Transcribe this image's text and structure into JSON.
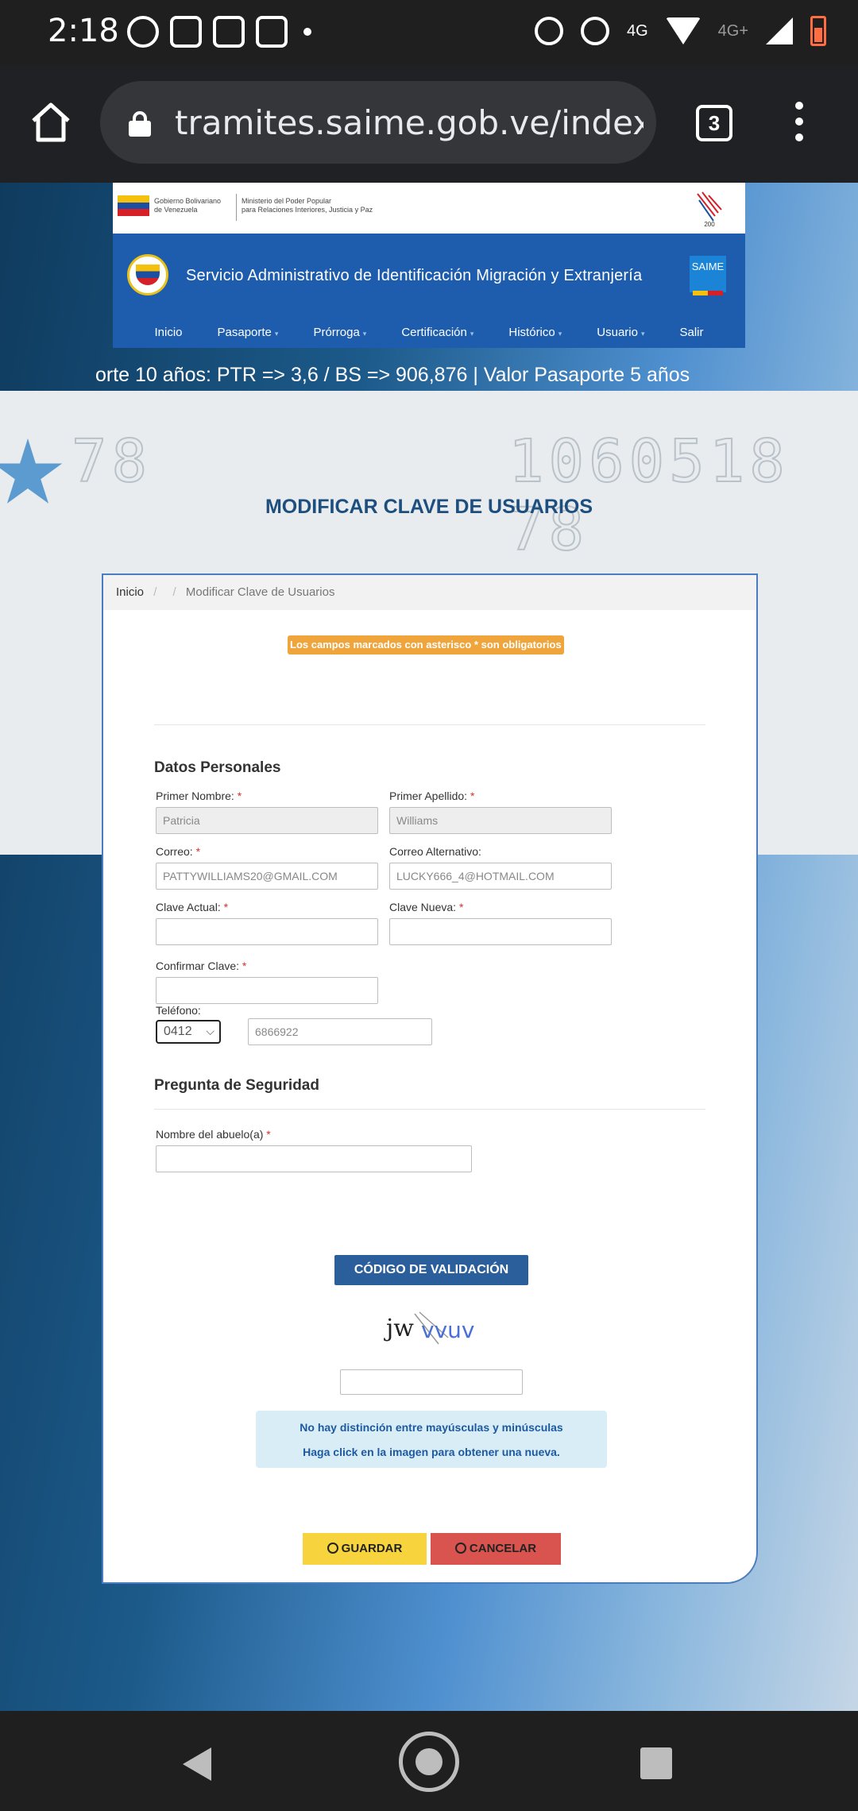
{
  "status_bar": {
    "time": "2:18",
    "app_icons": [
      "whatsapp-icon",
      "discord-icon",
      "teams-icon",
      "teams-icon"
    ],
    "network_label": "4G",
    "network_secondary": "4G+"
  },
  "browser": {
    "url": "tramites.saime.gob.ve/index.ph",
    "tab_count": "3"
  },
  "header": {
    "gov_text_line1": "Gobierno Bolivariano",
    "gov_text_line2": "de Venezuela",
    "ministry_line1": "Ministerio del Poder Popular",
    "ministry_line2": "para Relaciones Interiores, Justicia y Paz",
    "site_title": "Servicio Administrativo de Identificación Migración y Extranjería",
    "logo_text": "SAIME",
    "nav": [
      "Inicio",
      "Pasaporte",
      "Prórroga",
      "Certificación",
      "Histórico",
      "Usuario",
      "Salir"
    ]
  },
  "ticker": "orte 10 años: PTR => 3,6 / BS => 906,876 | Valor Pasaporte 5 años",
  "page_title": "MODIFICAR CLAVE DE USUARIOS",
  "breadcrumb": {
    "home": "Inicio",
    "separator": "/",
    "current": "Modificar Clave de Usuarios"
  },
  "required_notice": "Los campos marcados con asterisco * son obligatorios",
  "personal": {
    "title": "Datos Personales",
    "first_name_label": "Primer Nombre:",
    "first_name_value": "Patricia",
    "last_name_label": "Primer Apellido:",
    "last_name_value": "Williams",
    "email_label": "Correo:",
    "email_value": "PATTYWILLIAMS20@GMAIL.COM",
    "alt_email_label": "Correo Alternativo:",
    "alt_email_value": "LUCKY666_4@HOTMAIL.COM",
    "current_pw_label": "Clave Actual:",
    "new_pw_label": "Clave Nueva:",
    "confirm_pw_label": "Confirmar Clave:",
    "phone_label": "Teléfono:",
    "phone_prefix": "0412",
    "phone_number": "6866922",
    "required_mark": "*"
  },
  "security": {
    "title": "Pregunta de Seguridad",
    "question_label": "Nombre del abuelo(a)"
  },
  "validation": {
    "button": "CÓDIGO DE VALIDACIÓN",
    "captcha_text": "jwvvuv",
    "info_line1": "No hay distinción entre mayúsculas y minúsculas",
    "info_line2": "Haga click en la imagen para obtener una nueva."
  },
  "actions": {
    "save": "GUARDAR",
    "cancel": "CANCELAR"
  },
  "colors": {
    "primary_blue": "#1e5cae",
    "title_blue": "#1d4e7e",
    "warning_orange": "#efa53c",
    "save_yellow": "#f7d33d",
    "cancel_red": "#d9534f",
    "info_bg": "#d9edf7"
  }
}
